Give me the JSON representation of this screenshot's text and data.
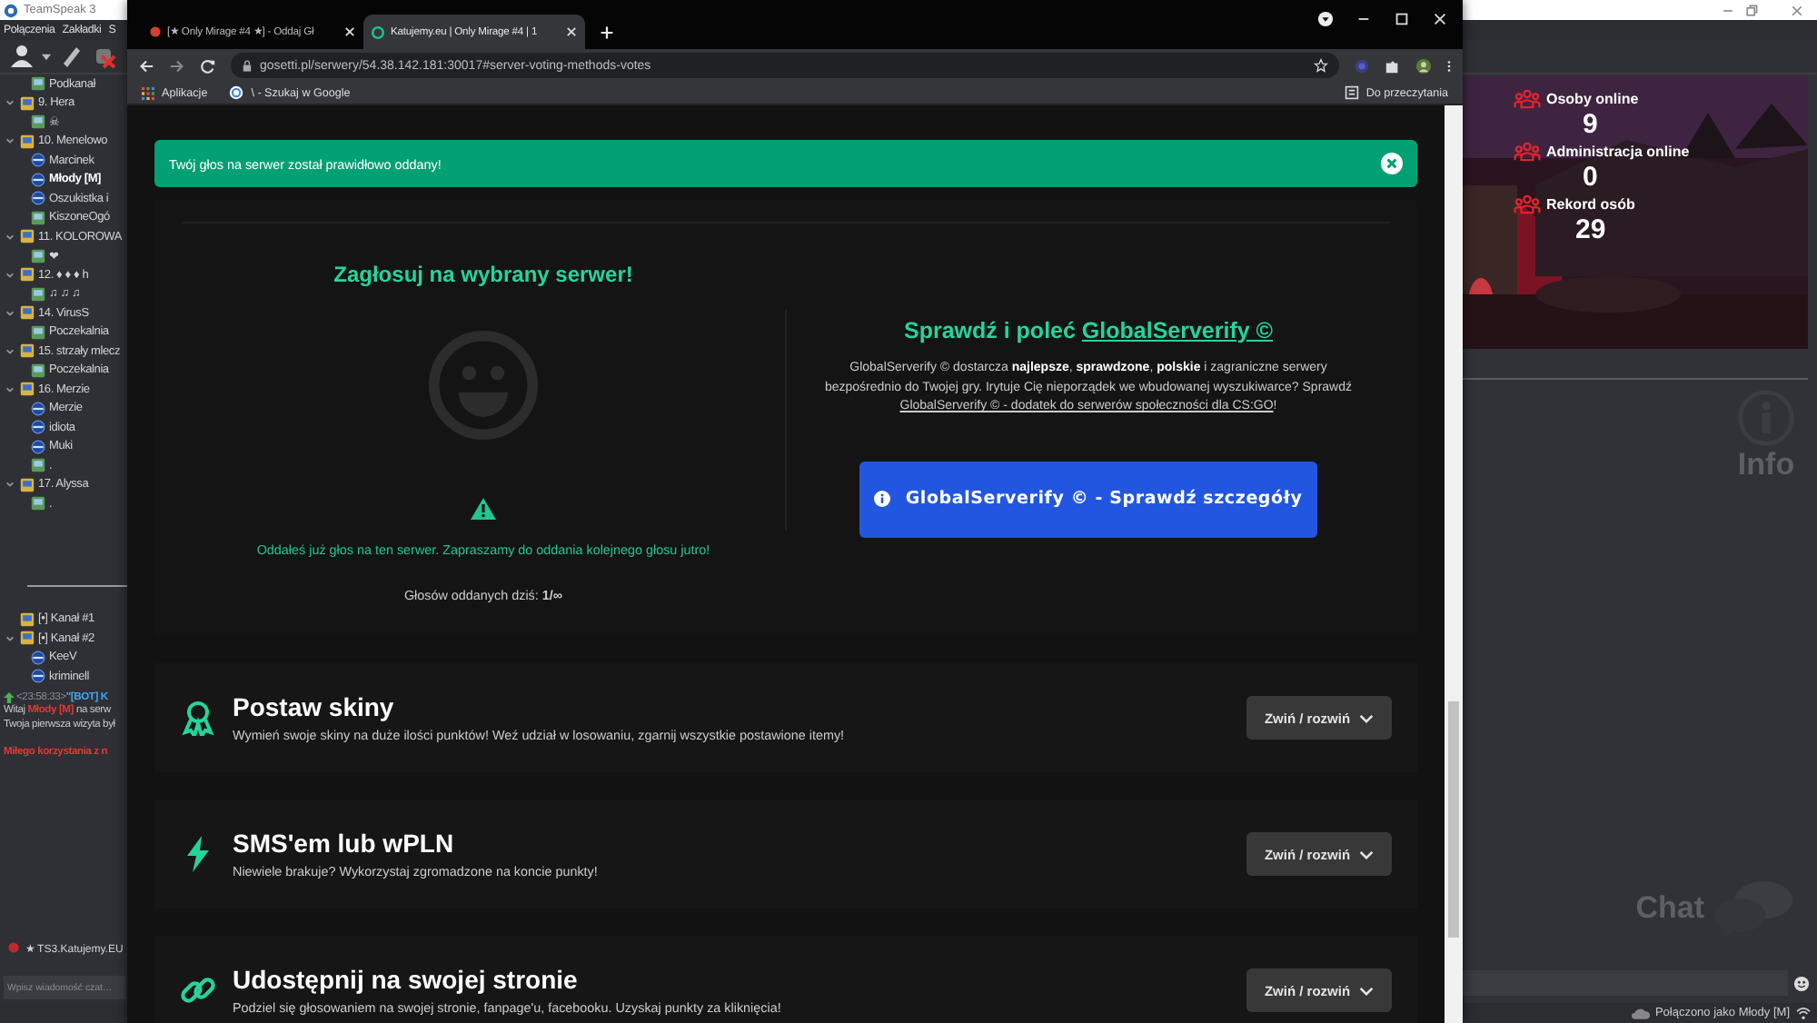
{
  "teamspeak": {
    "title": "TeamSpeak 3",
    "menu": [
      "Połączenia",
      "Zakładki",
      "S"
    ],
    "tree": [
      {
        "kind": "subchannel",
        "label": "Podkanał"
      },
      {
        "kind": "channel",
        "label": "9. Hera",
        "expanded": true,
        "children": [
          {
            "kind": "subchannel",
            "label": "☠"
          }
        ]
      },
      {
        "kind": "channel",
        "label": "10. Menelowo",
        "expanded": true,
        "children": [
          {
            "kind": "client",
            "label": "Marcinek",
            "self": false
          },
          {
            "kind": "client",
            "label": "Młody [M]",
            "self": true
          },
          {
            "kind": "client",
            "label": "Oszukistka i",
            "self": false
          },
          {
            "kind": "subchannel",
            "label": "KiszoneOgó"
          }
        ]
      },
      {
        "kind": "channel",
        "label": "11. KOLOROWA",
        "expanded": true,
        "children": [
          {
            "kind": "subchannel",
            "label": "❤"
          }
        ]
      },
      {
        "kind": "channel",
        "label": "12. ♦ ♦ ♦ h",
        "expanded": true,
        "children": [
          {
            "kind": "subchannel",
            "label": "♫ ♫ ♫"
          }
        ]
      },
      {
        "kind": "channel",
        "label": "14. VirusS",
        "expanded": true,
        "children": [
          {
            "kind": "subchannel",
            "label": "Poczekalnia"
          }
        ]
      },
      {
        "kind": "channel",
        "label": "15. strzały mlecz",
        "expanded": true,
        "children": [
          {
            "kind": "subchannel",
            "label": "Poczekalnia"
          }
        ]
      },
      {
        "kind": "channel",
        "label": "16. Merzie",
        "expanded": true,
        "children": [
          {
            "kind": "client",
            "label": "Merzie",
            "self": false
          },
          {
            "kind": "client",
            "label": "idiota",
            "self": false
          },
          {
            "kind": "client",
            "label": "Muki",
            "self": false
          },
          {
            "kind": "subchannel",
            "label": "."
          }
        ]
      },
      {
        "kind": "channel",
        "label": "17. Alyssa",
        "expanded": true,
        "children": [
          {
            "kind": "subchannel",
            "label": "."
          }
        ]
      }
    ],
    "lower_tree": [
      {
        "kind": "channel",
        "label": "[•] Kanał #1"
      },
      {
        "kind": "channel",
        "label": "[•] Kanał #2",
        "expanded": true,
        "children": [
          {
            "kind": "client",
            "label": "KeeV",
            "self": false
          },
          {
            "kind": "client",
            "label": "kriminell",
            "self": false
          }
        ]
      }
    ],
    "chat": [
      {
        "kind": "event",
        "segments": [
          {
            "kind": "time",
            "text": "<23:58:33>"
          },
          {
            "kind": "bot",
            "text": "\"[BOT] K"
          }
        ]
      },
      {
        "kind": "text",
        "segments": [
          {
            "kind": "plain",
            "text": "Witaj "
          },
          {
            "kind": "name",
            "text": "Młody [M]"
          },
          {
            "kind": "plain",
            "text": " na serw"
          }
        ]
      },
      {
        "kind": "text",
        "segments": [
          {
            "kind": "plain",
            "text": "Twoja pierwsza wizyta był"
          }
        ]
      },
      {
        "kind": "notice",
        "segments": [
          {
            "kind": "name",
            "text": "Miłego korzystania z n"
          }
        ]
      }
    ],
    "server_tab": "★ TS3.Katujemy.EU",
    "chat_input": {
      "placeholder": "Wpisz wiadomość czat…"
    },
    "banner": {
      "kind": "picture",
      "stats": [
        {
          "label": "Osoby online",
          "value": "9"
        },
        {
          "label": "Administracja online",
          "value": "0"
        },
        {
          "label": "Rekord osób",
          "value": "29"
        }
      ]
    },
    "info_label": "Info",
    "chat_label": "Chat",
    "status": "Połączono jako Młody [M]"
  },
  "browser": {
    "tabs": [
      {
        "title": "[★ Only Mirage #4 ★] - Oddaj Gł",
        "selected": false
      },
      {
        "title": "Katujemy.eu | Only Mirage #4 | 1",
        "selected": true
      }
    ],
    "url": "gosetti.pl/serwery/54.38.142.181:30017#server-voting-methods-votes",
    "bookmarks": [
      {
        "kind": "apps",
        "label": "Aplikacje"
      },
      {
        "kind": "google",
        "label": "\\ - Szukaj w Google"
      }
    ],
    "reading_list": "Do przeczytania"
  },
  "page": {
    "alert": "Twój głos na serwer został prawidłowo oddany!",
    "vote": {
      "title": "Zagłosuj na wybrany serwer!",
      "warning": "Oddałeś już głos na ten serwer. Zapraszamy do oddania kolejnego głosu jutro!",
      "count": "Głosów oddanych dziś: **1/∞**"
    },
    "promo": {
      "title": "Sprawdź i poleć ",
      "title_link": "GlobalServerify ©",
      "text": "GlobalServerify © dostarcza **najlepsze**, **sprawdzone**, **polskie** i zagraniczne serwery bezpośrednio do Twojej gry. Irytuje Cię nieporządek we wbudowanej wyszukiwarce? Sprawdź ",
      "text_link": "GlobalServerify © - dodatek do serwerów społeczności dla CS:GO",
      "text_end": "!",
      "button": "GlobalServerify © - Sprawdź szczegóły"
    },
    "sections": [
      {
        "title": "Postaw skiny",
        "desc": "Wymień swoje skiny na duże ilości punktów! Weź udział w losowaniu, zgarnij wszystkie postawione itemy!",
        "toggle": "Zwiń / rozwiń"
      },
      {
        "title": "SMS'em lub wPLN",
        "desc": "Niewiele brakuje? Wykorzystaj zgromadzone na koncie punkty!",
        "toggle": "Zwiń / rozwiń"
      },
      {
        "title": "Udostępnij na swojej stronie",
        "desc": "Podziel się głosowaniem na swojej stronie, fanpage'u, facebooku. Uzyskaj punkty za kliknięcia!",
        "toggle": "Zwiń / rozwiń"
      }
    ]
  }
}
